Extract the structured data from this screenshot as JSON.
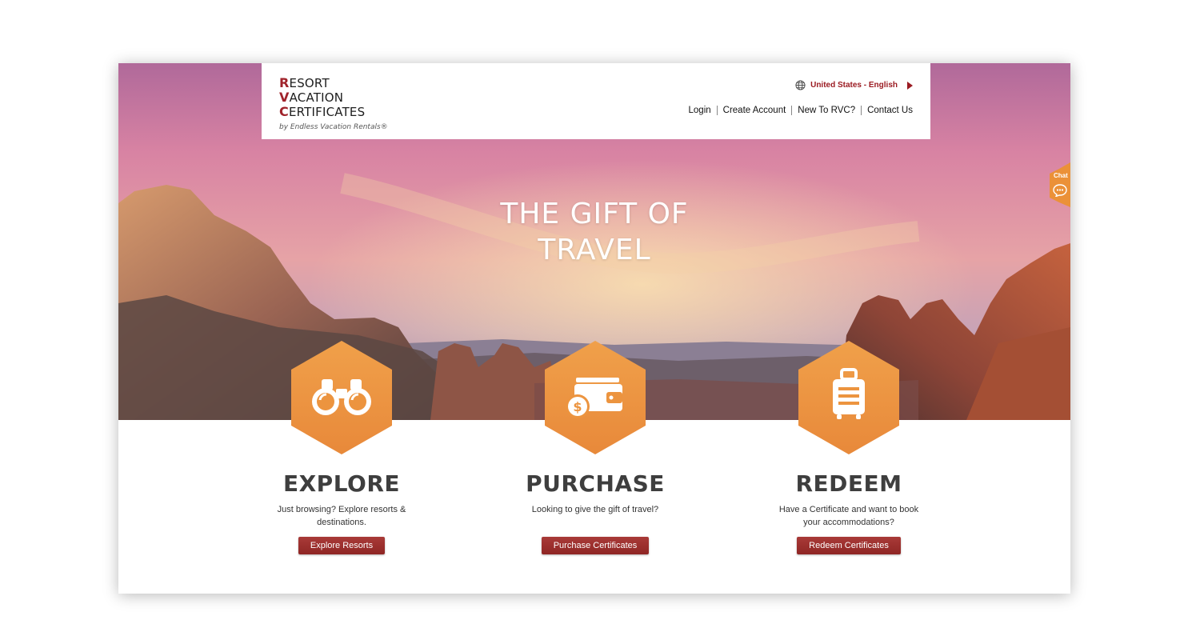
{
  "logo": {
    "line1_cap": "R",
    "line1_rest": "ESORT",
    "line2_cap": "V",
    "line2_rest": "ACATION",
    "line3_cap": "C",
    "line3_rest": "ERTIFICATES",
    "tagline": "by Endless Vacation Rentals®"
  },
  "locale": {
    "label": "United States - English",
    "icon": "globe-icon"
  },
  "nav": {
    "login": "Login",
    "create_account": "Create Account",
    "new_to_rvc": "New To RVC?",
    "contact_us": "Contact Us"
  },
  "hero": {
    "line1": "THE GIFT OF",
    "line2": "TRAVEL"
  },
  "chat": {
    "label": "Chat",
    "icon": "chat-bubble-icon"
  },
  "cards": [
    {
      "icon": "binoculars-icon",
      "title": "EXPLORE",
      "text": "Just browsing? Explore resorts & destinations.",
      "button": "Explore Resorts"
    },
    {
      "icon": "wallet-dollar-icon",
      "title": "PURCHASE",
      "text": "Looking to give the gift of travel?",
      "button": "Purchase Certificates"
    },
    {
      "icon": "suitcase-icon",
      "title": "REDEEM",
      "text": "Have a Certificate and want to book your accommodations?",
      "button": "Redeem Certificates"
    }
  ],
  "colors": {
    "brand_red": "#9b1b22",
    "accent_orange": "#eb9138",
    "button_red": "#9b2f2d"
  }
}
